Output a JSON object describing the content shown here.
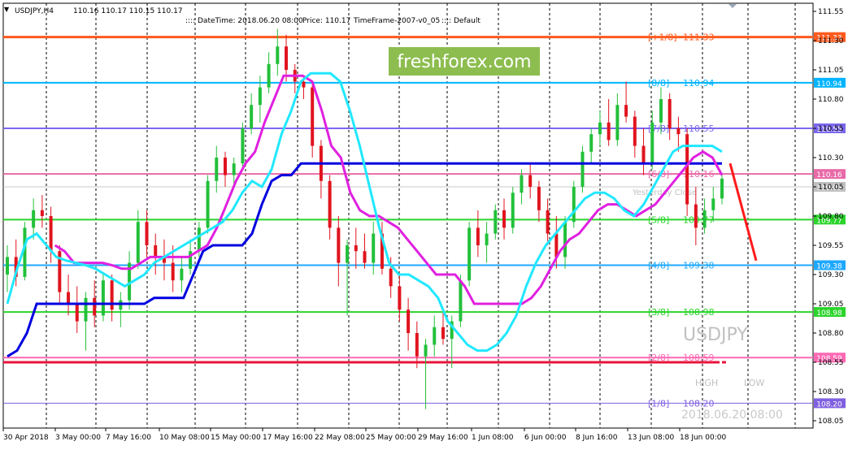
{
  "header": {
    "symbol": "USDJPY,H4",
    "ohlc": "110.16 110.17 110.15 110.17",
    "datetime": "DateTime: 2018.06.20 08:00",
    "price": "Price: 110.17",
    "timeframe": "TimeFrame-2007-v0_05",
    "mode": "Default"
  },
  "watermark": {
    "brand": "freshforex.com",
    "symbol": "USDJPY",
    "high_label": "HIGH",
    "low_label": "LOW",
    "timestamp": "2018.06.20 08:00",
    "yesterday_close": "Yesterday Close"
  },
  "colors": {
    "up": "#22c03a",
    "down": "#e0141e",
    "brand_bg": "#8dbd4f",
    "plus18": "#ff5a1e",
    "eight8": "#00b4ff",
    "seven8": "#7b68ee",
    "six8": "#e86aa8",
    "five8": "#2ad42a",
    "four8": "#1ea8ff",
    "three8": "#2ad42a",
    "two8": "#ff69b4",
    "one8": "#8060e0"
  },
  "chart_data": {
    "type": "candlestick",
    "title": "USDJPY,H4",
    "ylim": [
      108.05,
      111.55
    ],
    "y_ticks": [
      "111.55",
      "111.30",
      "111.05",
      "110.80",
      "110.55",
      "110.30",
      "110.05",
      "109.80",
      "109.55",
      "109.30",
      "109.05",
      "108.80",
      "108.55",
      "108.30",
      "108.05"
    ],
    "x_ticks": [
      "30 Apr 2018",
      "3 May 00:00",
      "7 May 16:00",
      "10 May 08:00",
      "15 May 00:00",
      "17 May 16:00",
      "22 May 08:00",
      "25 May 00:00",
      "29 May 16:00",
      "1 Jun 08:00",
      "6 Jun 00:00",
      "8 Jun 16:00",
      "13 Jun 08:00",
      "18 Jun 00:00"
    ],
    "murrey_levels": [
      {
        "label": "[+1/8]",
        "value": "111.33",
        "tag": "111.33",
        "ckey": "plus18"
      },
      {
        "label": "[8/8]",
        "value": "110.94",
        "tag": "110.94",
        "ckey": "eight8"
      },
      {
        "label": "[7/8]",
        "value": "110.55",
        "tag": "110.55",
        "ckey": "seven8"
      },
      {
        "label": "[6/8]",
        "value": "110.16",
        "tag": "110.16",
        "ckey": "six8"
      },
      {
        "label": "[5/8]",
        "value": "109.77",
        "tag": "109.77",
        "ckey": "five8"
      },
      {
        "label": "[4/8]",
        "value": "109.38",
        "tag": "109.38",
        "ckey": "four8"
      },
      {
        "label": "[3/8]",
        "value": "108.98",
        "tag": "108.98",
        "ckey": "three8"
      },
      {
        "label": "[2/8]",
        "value": "108.59",
        "tag": "108.59",
        "ckey": "two8"
      },
      {
        "label": "[1/8]",
        "value": "108.20",
        "tag": "108.20",
        "ckey": "one8"
      }
    ],
    "current_price_tag": "110.05",
    "candles": [
      [
        109.3,
        109.55,
        109.15,
        109.45
      ],
      [
        109.45,
        109.6,
        109.2,
        109.28
      ],
      [
        109.28,
        109.75,
        109.25,
        109.7
      ],
      [
        109.7,
        109.95,
        109.6,
        109.85
      ],
      [
        109.85,
        109.98,
        109.7,
        109.8
      ],
      [
        109.8,
        109.88,
        109.4,
        109.5
      ],
      [
        109.5,
        109.55,
        109.05,
        109.15
      ],
      [
        109.15,
        109.3,
        108.95,
        109.05
      ],
      [
        109.05,
        109.2,
        108.8,
        108.9
      ],
      [
        108.9,
        109.15,
        108.65,
        109.1
      ],
      [
        109.1,
        109.25,
        108.85,
        108.95
      ],
      [
        108.95,
        109.3,
        108.9,
        109.25
      ],
      [
        109.25,
        109.3,
        108.9,
        109.0
      ],
      [
        109.0,
        109.15,
        108.85,
        109.08
      ],
      [
        109.08,
        109.5,
        109.0,
        109.4
      ],
      [
        109.4,
        109.85,
        109.35,
        109.75
      ],
      [
        109.75,
        109.85,
        109.45,
        109.55
      ],
      [
        109.55,
        109.65,
        109.3,
        109.45
      ],
      [
        109.45,
        109.6,
        109.25,
        109.4
      ],
      [
        109.4,
        109.55,
        109.15,
        109.25
      ],
      [
        109.25,
        109.45,
        109.15,
        109.35
      ],
      [
        109.35,
        109.6,
        109.3,
        109.5
      ],
      [
        109.5,
        109.75,
        109.45,
        109.7
      ],
      [
        109.7,
        110.15,
        109.65,
        110.1
      ],
      [
        110.1,
        110.4,
        110.0,
        110.3
      ],
      [
        110.3,
        110.35,
        110.05,
        110.15
      ],
      [
        110.15,
        110.3,
        110.05,
        110.25
      ],
      [
        110.25,
        110.6,
        110.2,
        110.55
      ],
      [
        110.55,
        110.85,
        110.5,
        110.75
      ],
      [
        110.75,
        111.0,
        110.6,
        110.9
      ],
      [
        110.9,
        111.2,
        110.85,
        111.1
      ],
      [
        111.1,
        111.4,
        111.0,
        111.25
      ],
      [
        111.25,
        111.35,
        110.95,
        111.05
      ],
      [
        111.05,
        111.1,
        110.85,
        110.95
      ],
      [
        110.95,
        111.0,
        110.8,
        110.9
      ],
      [
        110.9,
        110.95,
        110.3,
        110.4
      ],
      [
        110.4,
        110.45,
        109.95,
        110.1
      ],
      [
        110.1,
        110.15,
        109.6,
        109.7
      ],
      [
        109.7,
        109.8,
        109.2,
        109.4
      ],
      [
        109.4,
        109.6,
        108.95,
        109.55
      ],
      [
        109.55,
        109.7,
        109.35,
        109.5
      ],
      [
        109.5,
        109.65,
        109.35,
        109.4
      ],
      [
        109.4,
        109.75,
        109.3,
        109.65
      ],
      [
        109.65,
        109.75,
        109.3,
        109.35
      ],
      [
        109.35,
        109.45,
        109.1,
        109.2
      ],
      [
        109.2,
        109.3,
        108.9,
        109.0
      ],
      [
        109.0,
        109.1,
        108.65,
        108.8
      ],
      [
        108.8,
        108.9,
        108.5,
        108.6
      ],
      [
        108.6,
        108.75,
        108.15,
        108.7
      ],
      [
        108.7,
        108.95,
        108.6,
        108.85
      ],
      [
        108.85,
        109.0,
        108.7,
        108.75
      ],
      [
        108.75,
        108.95,
        108.5,
        108.9
      ],
      [
        108.9,
        109.3,
        108.85,
        109.25
      ],
      [
        109.25,
        109.75,
        109.2,
        109.7
      ],
      [
        109.7,
        109.85,
        109.45,
        109.55
      ],
      [
        109.55,
        109.75,
        109.4,
        109.65
      ],
      [
        109.65,
        109.9,
        109.6,
        109.85
      ],
      [
        109.85,
        109.95,
        109.6,
        109.7
      ],
      [
        109.7,
        110.05,
        109.65,
        110.0
      ],
      [
        110.0,
        110.2,
        109.9,
        110.15
      ],
      [
        110.15,
        110.25,
        109.95,
        110.05
      ],
      [
        110.05,
        110.1,
        109.75,
        109.85
      ],
      [
        109.85,
        109.95,
        109.55,
        109.65
      ],
      [
        109.65,
        109.8,
        109.35,
        109.45
      ],
      [
        109.45,
        109.8,
        109.35,
        109.75
      ],
      [
        109.75,
        110.1,
        109.7,
        110.05
      ],
      [
        110.05,
        110.4,
        110.0,
        110.35
      ],
      [
        110.35,
        110.55,
        110.25,
        110.5
      ],
      [
        110.5,
        110.7,
        110.4,
        110.6
      ],
      [
        110.6,
        110.8,
        110.4,
        110.45
      ],
      [
        110.45,
        110.85,
        110.4,
        110.75
      ],
      [
        110.75,
        110.95,
        110.6,
        110.65
      ],
      [
        110.65,
        110.7,
        110.3,
        110.4
      ],
      [
        110.4,
        110.55,
        110.15,
        110.25
      ],
      [
        110.25,
        110.7,
        110.2,
        110.6
      ],
      [
        110.6,
        110.9,
        110.5,
        110.8
      ],
      [
        110.8,
        110.85,
        110.45,
        110.55
      ],
      [
        110.55,
        110.65,
        110.35,
        110.5
      ],
      [
        110.5,
        110.55,
        109.8,
        109.9
      ],
      [
        109.9,
        110.05,
        109.55,
        109.7
      ],
      [
        109.7,
        109.95,
        109.65,
        109.85
      ],
      [
        109.85,
        110.05,
        109.75,
        109.95
      ],
      [
        109.95,
        110.15,
        109.9,
        110.12
      ]
    ],
    "lines": {
      "cyan": [
        109.05,
        109.35,
        109.6,
        109.65,
        109.55,
        109.45,
        109.42,
        109.4,
        109.38,
        109.35,
        109.3,
        109.25,
        109.2,
        109.25,
        109.3,
        109.4,
        109.45,
        109.5,
        109.55,
        109.6,
        109.65,
        109.7,
        109.75,
        109.85,
        110.0,
        110.1,
        110.05,
        110.2,
        110.5,
        110.7,
        110.95,
        111.02,
        111.02,
        111.02,
        110.95,
        110.7,
        110.4,
        110.05,
        109.7,
        109.4,
        109.3,
        109.3,
        109.25,
        109.2,
        109.1,
        108.9,
        108.8,
        108.7,
        108.65,
        108.65,
        108.7,
        108.8,
        108.95,
        109.2,
        109.4,
        109.55,
        109.65,
        109.75,
        109.85,
        109.95,
        110.0,
        110.0,
        109.95,
        109.85,
        109.8,
        109.9,
        110.05,
        110.2,
        110.35,
        110.4,
        110.4,
        110.4,
        110.4,
        110.35
      ],
      "magenta": [
        null,
        null,
        null,
        null,
        null,
        109.55,
        109.5,
        109.4,
        109.4,
        109.4,
        109.4,
        109.38,
        109.35,
        109.35,
        109.4,
        109.45,
        109.45,
        109.45,
        109.45,
        109.45,
        109.5,
        109.55,
        109.7,
        109.9,
        110.1,
        110.25,
        110.35,
        110.6,
        110.8,
        111.0,
        111.0,
        111.0,
        110.95,
        110.7,
        110.4,
        110.3,
        110.0,
        109.85,
        109.8,
        109.8,
        109.75,
        109.7,
        109.6,
        109.5,
        109.4,
        109.3,
        109.3,
        109.3,
        109.2,
        109.05,
        109.05,
        109.05,
        109.05,
        109.05,
        109.05,
        109.1,
        109.2,
        109.35,
        109.5,
        109.6,
        109.65,
        109.75,
        109.85,
        109.9,
        109.9,
        109.85,
        109.8,
        109.85,
        109.9,
        110.0,
        110.1,
        110.2,
        110.3,
        110.35,
        110.3,
        110.15
      ],
      "blue": [
        108.6,
        108.65,
        108.8,
        109.05,
        109.05,
        109.05,
        109.05,
        109.05,
        109.05,
        109.05,
        109.05,
        109.05,
        109.05,
        109.05,
        109.05,
        109.1,
        109.1,
        109.1,
        109.1,
        109.3,
        109.5,
        109.55,
        109.55,
        109.55,
        109.55,
        109.65,
        109.9,
        110.1,
        110.15,
        110.15,
        110.25,
        110.25,
        110.25,
        110.25,
        110.25,
        110.25,
        110.25,
        110.25,
        110.25,
        110.25,
        110.25,
        110.25,
        110.25,
        110.25,
        110.25,
        110.25,
        110.25,
        110.25,
        110.25,
        110.25,
        110.25,
        110.25,
        110.25,
        110.25,
        110.25,
        110.25,
        110.25,
        110.25,
        110.25,
        110.25,
        110.25,
        110.25,
        110.25,
        110.25,
        110.25,
        110.25,
        110.25,
        110.25,
        110.25,
        110.25,
        110.25,
        110.25,
        110.25,
        110.25
      ]
    },
    "forecast": [
      [
        110.25,
        109.42
      ]
    ]
  }
}
